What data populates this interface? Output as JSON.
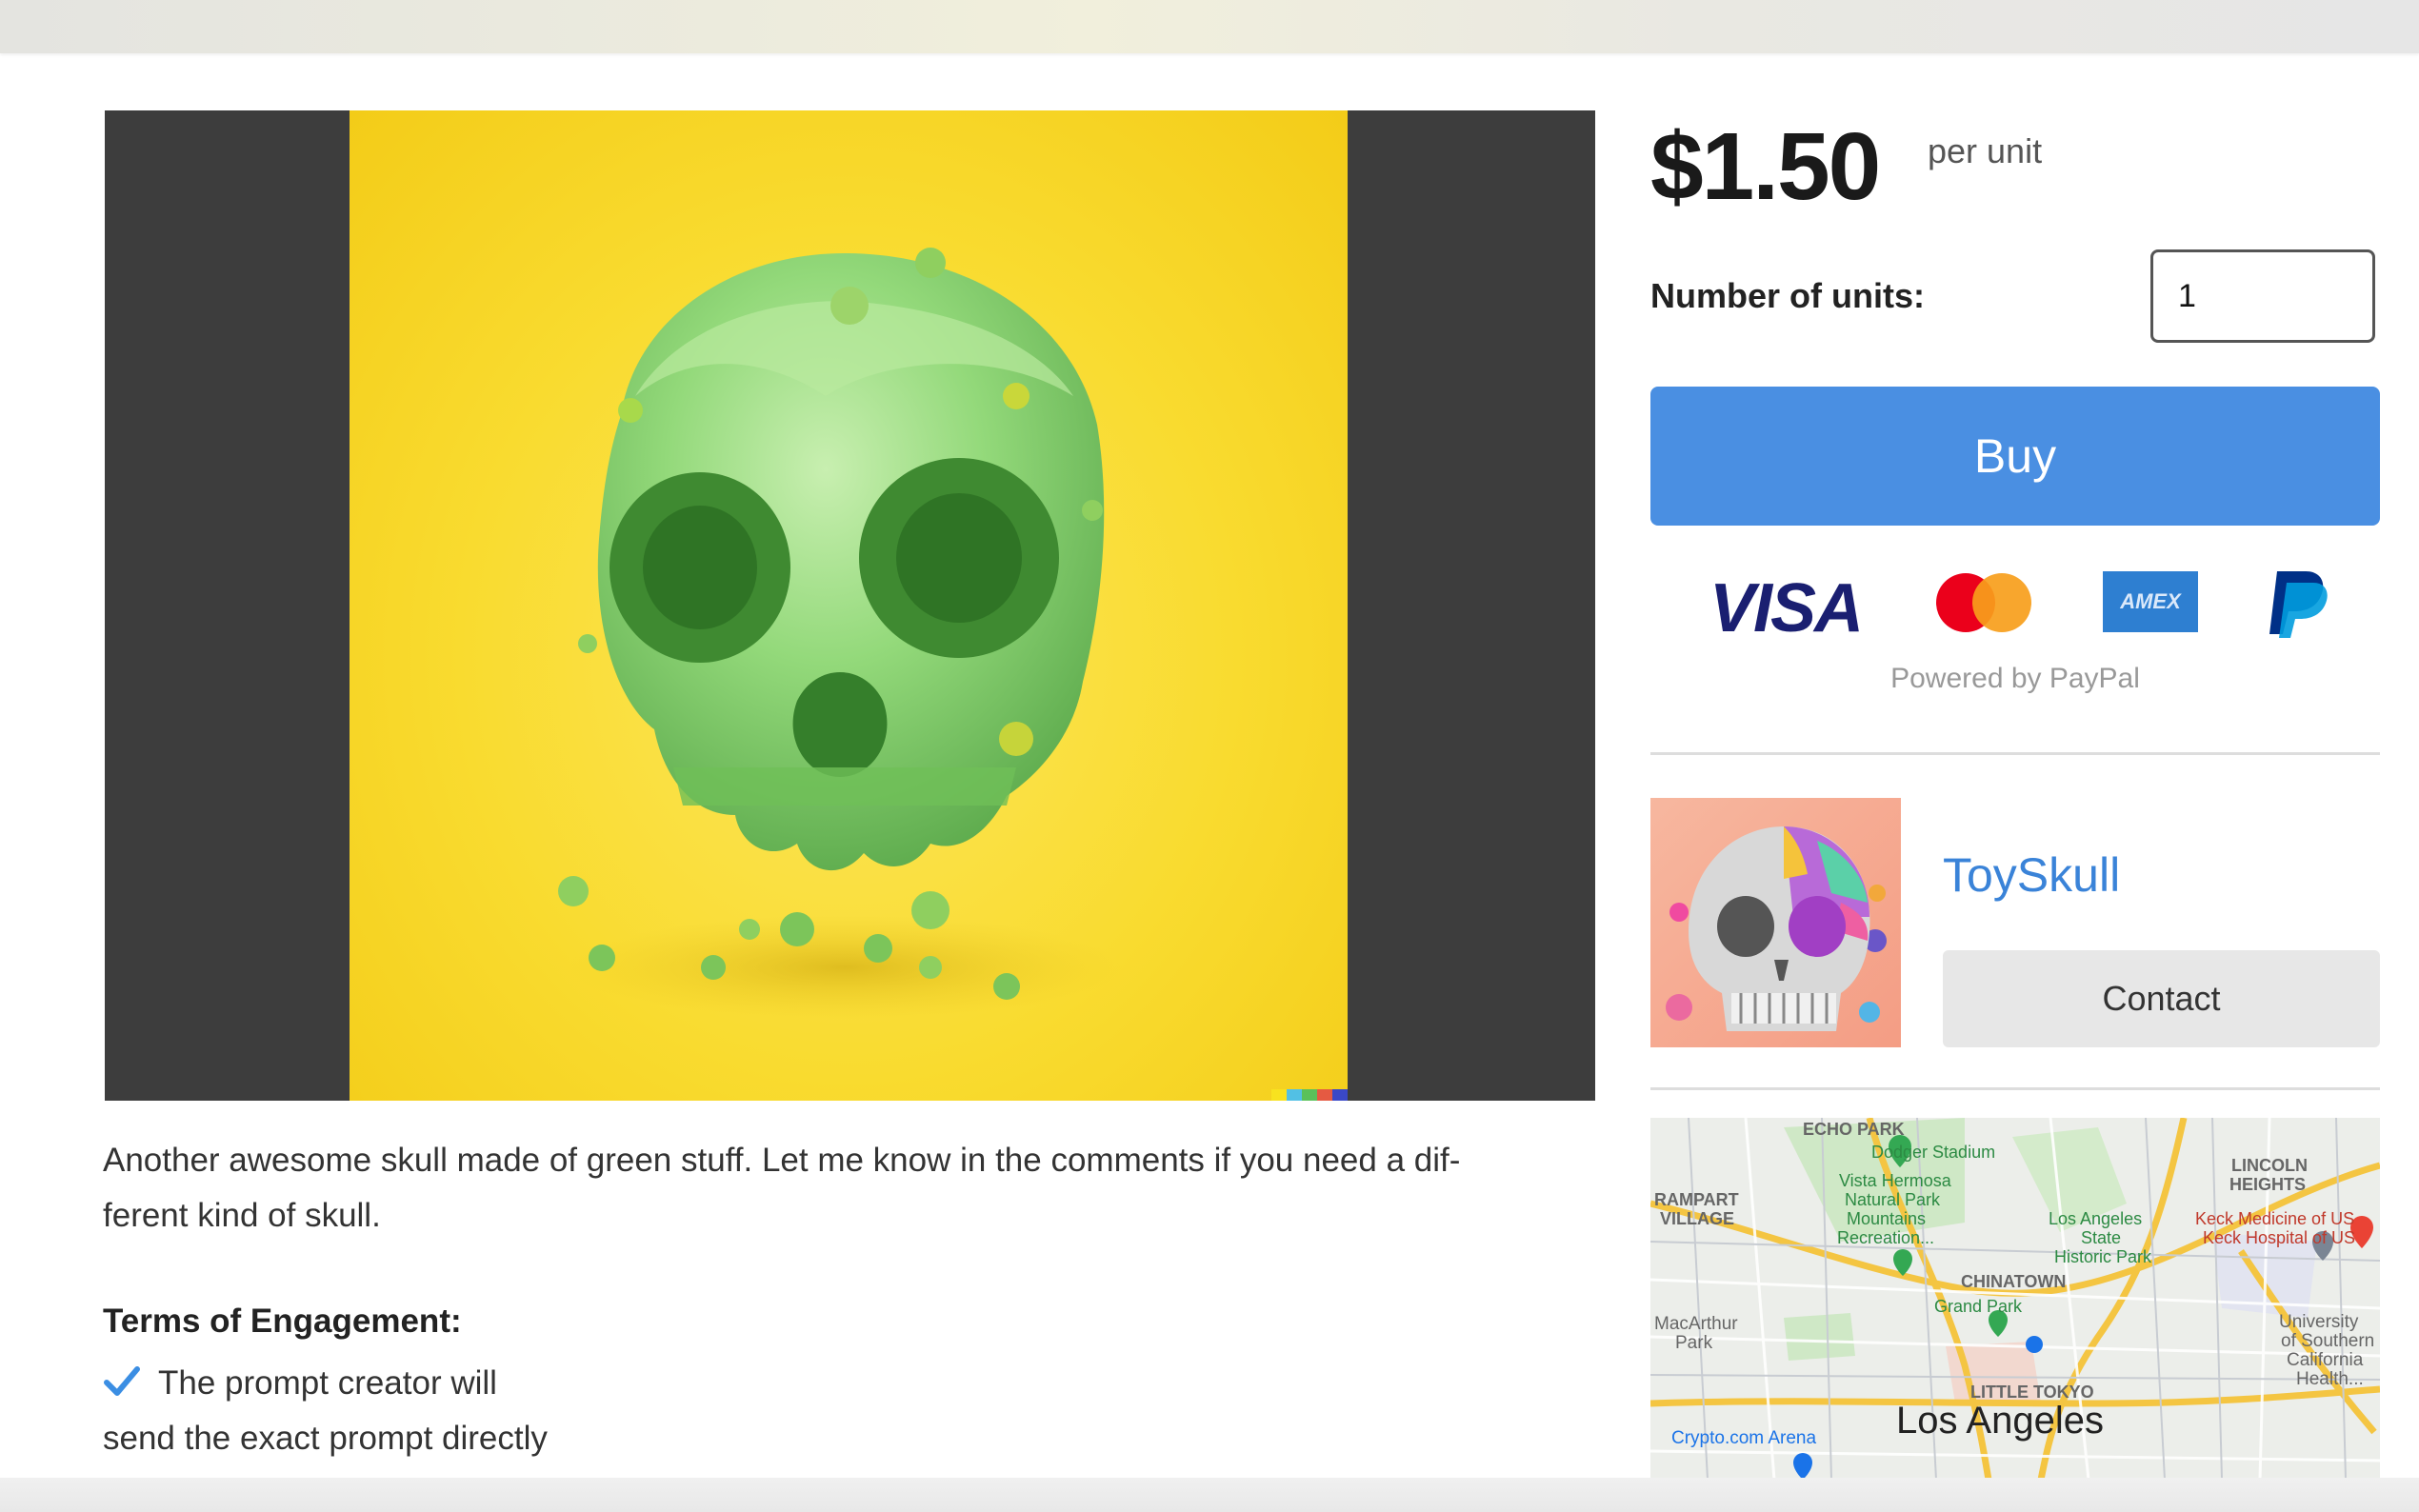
{
  "listing": {
    "description_line1": "Another awesome skull made of green stuff. Let me know in the comments if you need a dif-",
    "description_line2": "ferent kind of skull.",
    "terms_title": "Terms of Engagement:",
    "terms_item_line1": "The prompt creator will",
    "terms_item_line2": "send the exact prompt directly"
  },
  "purchase": {
    "price": "$1.50",
    "per_unit": "per unit",
    "units_label": "Number of units:",
    "units_value": "1",
    "buy_label": "Buy",
    "powered_by": "Powered by PayPal",
    "payment_icons": [
      "visa-icon",
      "mastercard-icon",
      "amex-icon",
      "paypal-icon"
    ],
    "visa_text": "VISA",
    "amex_text": "AMEX"
  },
  "seller": {
    "name": "ToySkull",
    "contact_label": "Contact"
  },
  "map": {
    "labels": {
      "echo_park": "ECHO PARK",
      "dodger": "Dodger Stadium",
      "lincoln1": "LINCOLN",
      "lincoln2": "HEIGHTS",
      "rampart1": "RAMPART",
      "rampart2": "VILLAGE",
      "vista1": "Vista Hermosa",
      "vista2": "Natural Park",
      "mount1": "Mountains",
      "mount2": "Recreation...",
      "la_state1": "Los Angeles",
      "la_state2": "State",
      "la_state3": "Historic Park",
      "keck1": "Keck Medicine of US",
      "keck2": "Keck Hospital of US",
      "chinatown": "CHINATOWN",
      "grand_park": "Grand Park",
      "macarthur1": "MacArthur",
      "macarthur2": "Park",
      "usc1": "University",
      "usc2": "of Southern",
      "usc3": "California",
      "usc4": "Health...",
      "little_tokyo": "LITTLE TOKYO",
      "city": "Los Angeles",
      "crypto": "Crypto.com Arena"
    }
  },
  "colors": {
    "buy_button": "#4a8fe2",
    "seller_link": "#3a83d8",
    "artwork_background": "#f9db2f",
    "viewer_background": "#3d3d3d"
  }
}
